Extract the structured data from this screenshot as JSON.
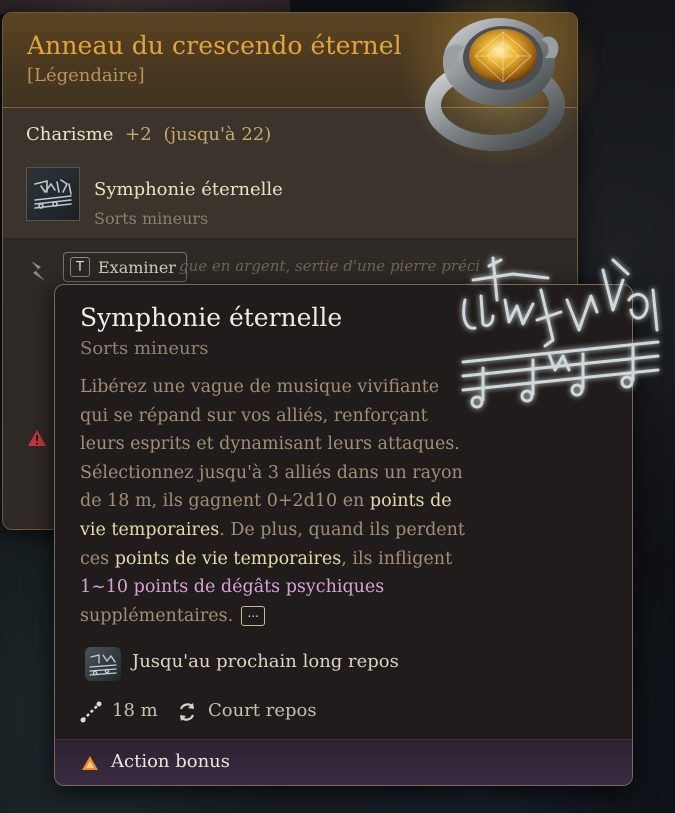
{
  "item": {
    "title": "Anneau du crescendo éternel",
    "rarity": "[Légendaire]",
    "stat_name": "Charisme",
    "stat_bonus": "+2",
    "stat_cap": "(jusqu'à 22)",
    "spell_name": "Symphonie éternelle",
    "spell_school": "Sorts mineurs",
    "examine_key": "T",
    "examine_label": "Examiner",
    "description_fragment": "gue en argent, sertie d'une pierre préci",
    "accent_color": "#e3a53b",
    "icons": [
      "ring-icon",
      "lightning-icon",
      "warning-icon",
      "spell-icon"
    ]
  },
  "spell": {
    "title": "Symphonie éternelle",
    "school": "Sorts mineurs",
    "desc_part1": "Libérez une vague de musique vivifiante qui se répand sur vos alliés, renforçant leurs esprits et dynamisant leurs attaques. Sélectionnez jusqu'à 3 alliés dans un rayon de 18 m, ils gagnent 0+2d10 en ",
    "desc_temp1": "points de vie temporaires",
    "desc_part2": ". De plus, quand ils perdent ces ",
    "desc_temp2": "points de vie temporaires",
    "desc_part3": ", ils infligent ",
    "desc_dmg": "1~10 points de dégâts psychiques",
    "desc_part4": " supplémentaires.",
    "more_label": "...",
    "duration": "Jusqu'au prochain long repos",
    "range": "18 m",
    "recharge": "Court repos",
    "action_type": "Action bonus",
    "highlight_temp_color": "#e4dcaa",
    "highlight_damage_color": "#d7a3d6",
    "icons": [
      "spell-icon",
      "range-icon",
      "recharge-icon",
      "bonus-action-icon"
    ]
  }
}
